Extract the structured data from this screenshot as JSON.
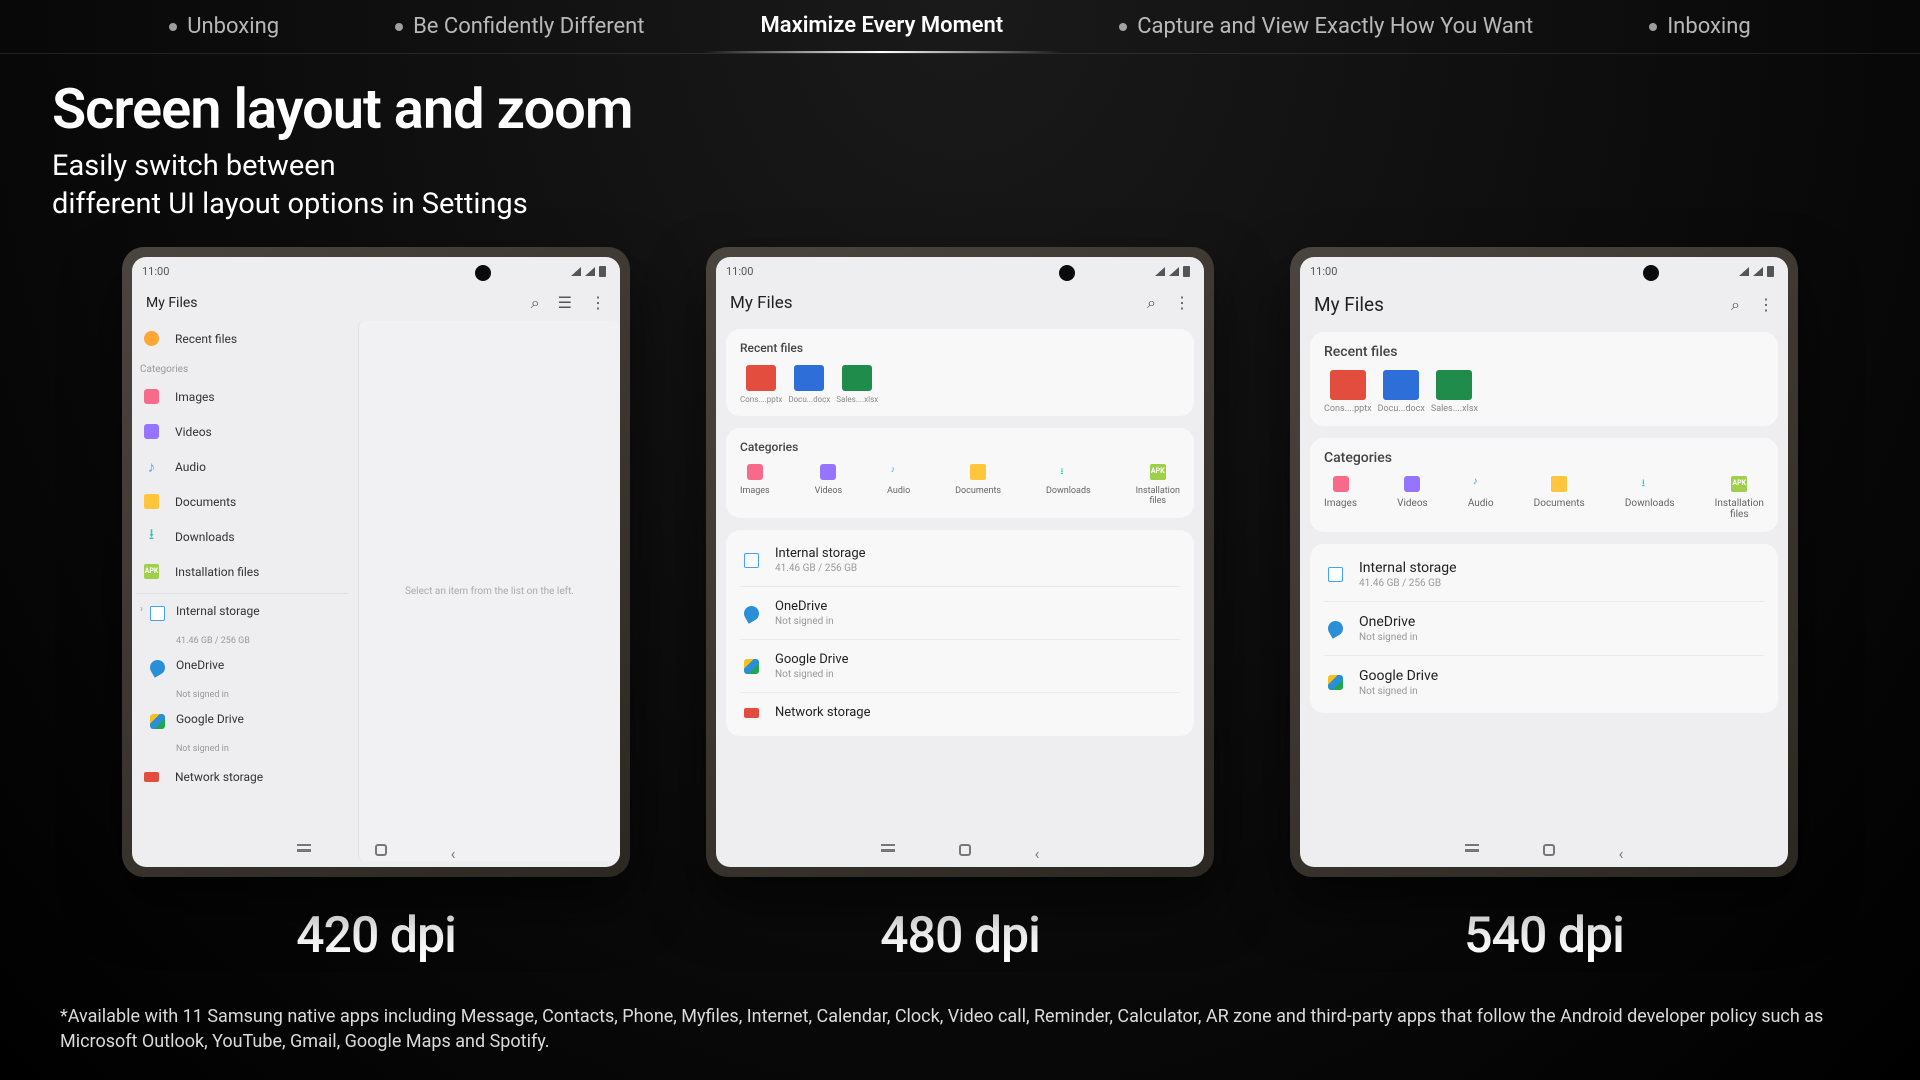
{
  "nav": {
    "items": [
      "Unboxing",
      "Be Confidently Different",
      "Maximize Every Moment",
      "Capture and View Exactly How You Want",
      "Inboxing"
    ],
    "activeIndex": 2
  },
  "heading": {
    "title": "Screen layout and zoom",
    "subtitle": "Easily switch between\ndifferent UI layout options in Settings"
  },
  "dpi": [
    "420 dpi",
    "480 dpi",
    "540 dpi"
  ],
  "phone": {
    "time": "11:00",
    "appTitle": "My Files",
    "emptyMsg": "Select an item from the list on the left.",
    "sections": {
      "recent": "Recent files",
      "categories": "Categories"
    },
    "categories": [
      "Images",
      "Videos",
      "Audio",
      "Documents",
      "Downloads",
      "Installation files"
    ],
    "categoriesShort": [
      "Images",
      "Videos",
      "Audio",
      "Documents",
      "Downloads",
      "Installation\nfiles"
    ],
    "recentFiles": [
      {
        "name": "Cons....pptx",
        "kind": "ppt"
      },
      {
        "name": "Docu...docx",
        "kind": "doc"
      },
      {
        "name": "Sales....xlsx",
        "kind": "xls"
      }
    ],
    "storage": [
      {
        "title": "Internal storage",
        "sub": "41.46 GB / 256 GB",
        "icon": "sd"
      },
      {
        "title": "OneDrive",
        "sub": "Not signed in",
        "icon": "cloud"
      },
      {
        "title": "Google Drive",
        "sub": "Not signed in",
        "icon": "gdrive"
      },
      {
        "title": "Network storage",
        "sub": "",
        "icon": "net"
      }
    ]
  },
  "footnote": "*Available with 11 Samsung native apps including Message, Contacts, Phone, Myfiles, Internet, Calendar, Clock, Video call, Reminder, Calculator, AR zone and third-party apps that follow the Android developer policy such as Microsoft Outlook, YouTube, Gmail, Google Maps and Spotify."
}
